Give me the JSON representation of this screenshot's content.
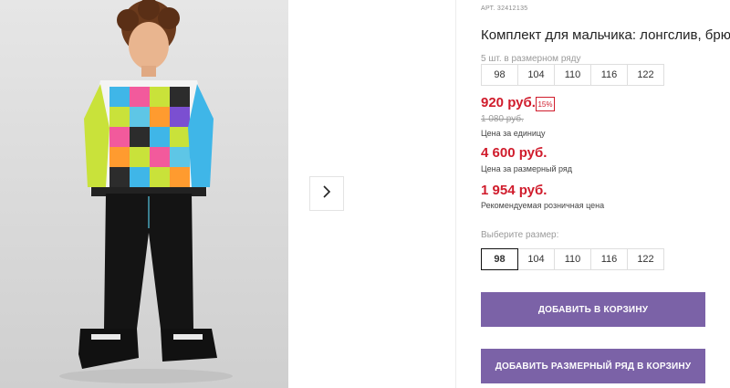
{
  "product": {
    "article": "АРТ. 32412135",
    "title": "Комплект для мальчика: лонгслив, брюки",
    "pack_label": "5 шт. в размерном ряду",
    "pack_sizes": [
      "98",
      "104",
      "110",
      "116",
      "122"
    ],
    "price": "920 руб.",
    "discount_badge": "15%",
    "old_price": "1 080 руб.",
    "unit_price_caption": "Цена за единицу",
    "pack_price": "4 600 руб.",
    "pack_price_caption": "Цена за размерный ряд",
    "retail_price": "1 954 руб.",
    "retail_price_caption": "Рекомендуемая розничная цена",
    "choose_size_label": "Выберите размер:",
    "sizes": [
      "98",
      "104",
      "110",
      "116",
      "122"
    ],
    "selected_size": "98",
    "add_to_cart": "ДОБАВИТЬ В КОРЗИНУ",
    "add_pack_to_cart": "ДОБАВИТЬ РАЗМЕРНЫЙ РЯД В КОРЗИНУ"
  },
  "colors": {
    "accent": "#7b62a7",
    "price_red": "#d01c2c"
  },
  "icons": {
    "next": "chevron-right-icon"
  }
}
